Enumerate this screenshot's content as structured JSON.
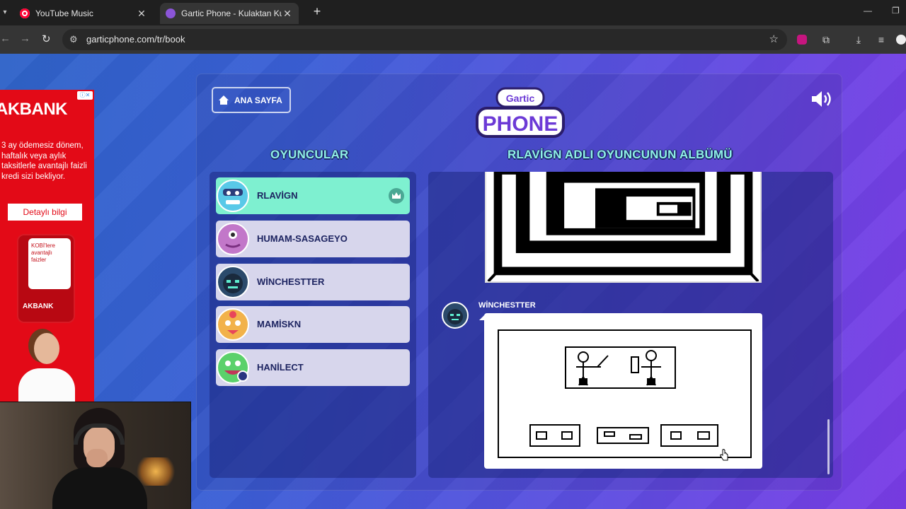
{
  "browser": {
    "tabs": [
      {
        "title": "YouTube Music"
      },
      {
        "title": "Gartic Phone - Kulaktan Kulağa"
      }
    ],
    "url": "garticphone.com/tr/book"
  },
  "ad": {
    "brand": "AKBANK",
    "copy": "3 ay ödemesiz dönem, haftalık veya aylık taksitlerle avantajlı faizli kredi sizi bekliyor.",
    "cta": "Detaylı bilgi",
    "card_text": "KOBİ'lere avantajlı faizler",
    "phone_brand": "AKBANK"
  },
  "game": {
    "home_label": "ANA SAYFA",
    "logo_top": "Gartic",
    "logo_bottom": "PHONE",
    "players_title": "OYUNCULAR",
    "album_title": "RLAVİGN ADLI OYUNCUNUN ALBÜMÜ",
    "players": [
      {
        "name": "RLAVİGN",
        "color": "#59c9e8"
      },
      {
        "name": "HUMAM-SASAGEYO",
        "color": "#c277c9"
      },
      {
        "name": "WİNCHESTTER",
        "color": "#2b4a6b"
      },
      {
        "name": "MAMİSKN",
        "color": "#f2b24a"
      },
      {
        "name": "HANİLECT",
        "color": "#5bd16b"
      }
    ],
    "current_drawer": "WİNCHESTTER"
  },
  "colors": {
    "active_player": "#7ef0d0",
    "player_bg": "#d7d6ec",
    "title_teal": "#8ff0e6"
  }
}
